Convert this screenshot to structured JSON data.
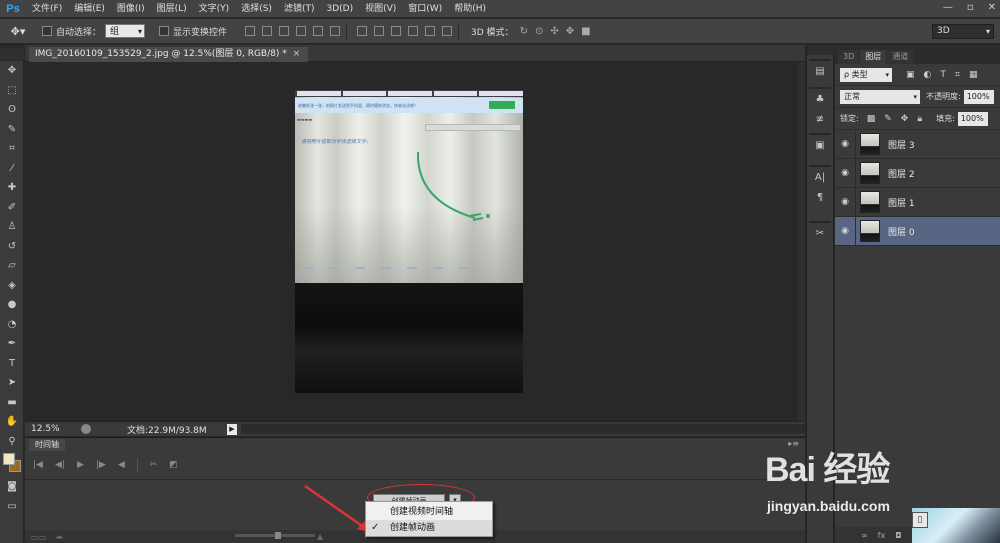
{
  "app": {
    "logo": "Ps"
  },
  "menu": [
    "文件(F)",
    "编辑(E)",
    "图像(I)",
    "图层(L)",
    "文字(Y)",
    "选择(S)",
    "滤镜(T)",
    "3D(D)",
    "视图(V)",
    "窗口(W)",
    "帮助(H)"
  ],
  "window_controls": [
    "—",
    "▫",
    "✕"
  ],
  "options": {
    "auto_select_label": "自动选择：",
    "auto_select_value": "组",
    "show_transform_label": "显示变换控件",
    "mode3d_label": "3D 模式：",
    "workspace": "3D"
  },
  "document": {
    "tab_title": "IMG_20160109_153529_2.jpg @ 12.5%(图层 0, RGB/8) *",
    "close": "×",
    "zoom": "12.5%",
    "doc_info": "文档:22.9M/93.8M"
  },
  "photo": {
    "handwriting": "请用照片提取对字体选择文字。",
    "banner_text": "收集纸张一张，拍照片发送到手机里，随时随地浏览，快来试试吧！"
  },
  "timeline": {
    "tab": "时间轴",
    "create_button": "创建帧动画",
    "context_menu": [
      {
        "label": "创建视频时间轴",
        "checked": false
      },
      {
        "label": "创建帧动画",
        "checked": true
      }
    ],
    "check_mark": "✓"
  },
  "layers_panel": {
    "tabs": [
      "3D",
      "图层",
      "通道"
    ],
    "active_tab": "图层",
    "filter": "ρ 类型",
    "blend_mode": "正常",
    "opacity_label": "不透明度:",
    "opacity_value": "100%",
    "lock_label": "锁定:",
    "fill_label": "填充:",
    "fill_value": "100%",
    "layers": [
      {
        "name": "图层 3",
        "selected": false
      },
      {
        "name": "图层 2",
        "selected": false
      },
      {
        "name": "图层 1",
        "selected": false
      },
      {
        "name": "图层 0",
        "selected": true
      }
    ],
    "footer": "fx"
  },
  "watermark": {
    "logo": "Bai  经验",
    "url": "jingyan.baidu.com"
  },
  "colors": {
    "accent": "#31a8ff",
    "selection": "#586683",
    "annotation": "#dd3333"
  }
}
